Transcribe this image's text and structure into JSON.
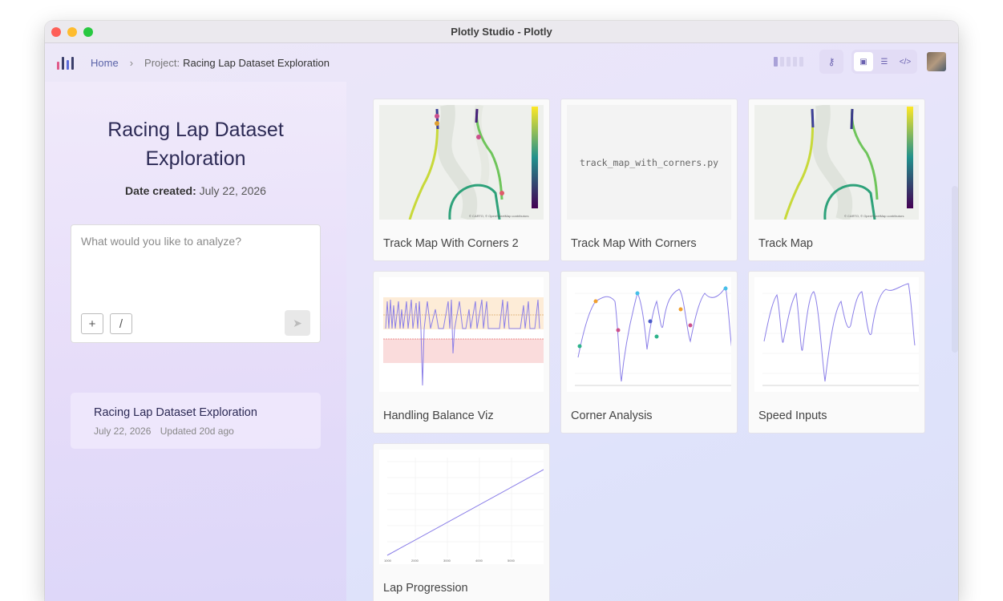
{
  "window": {
    "title": "Plotly Studio - Plotly"
  },
  "breadcrumb": {
    "home": "Home",
    "project_prefix": "Project:",
    "project_name": "Racing Lap Dataset Exploration"
  },
  "project": {
    "title": "Racing Lap Dataset Exploration",
    "date_label": "Date created:",
    "date_value": "July 22, 2026"
  },
  "prompt": {
    "placeholder": "What would you like to analyze?",
    "add_label": "+",
    "slash_label": "/"
  },
  "recent": {
    "title": "Racing Lap Dataset Exploration",
    "date": "July 22, 2026",
    "updated": "Updated 20d ago"
  },
  "cards": [
    {
      "label": "Track Map With Corners 2",
      "kind": "map"
    },
    {
      "label": "Track Map With Corners",
      "kind": "code",
      "code": "track_map_with_corners.py"
    },
    {
      "label": "Track Map",
      "kind": "map"
    },
    {
      "label": "Handling Balance Viz",
      "kind": "balance"
    },
    {
      "label": "Corner Analysis",
      "kind": "corner"
    },
    {
      "label": "Speed Inputs",
      "kind": "speed"
    },
    {
      "label": "Lap Progression",
      "kind": "lap"
    }
  ],
  "colors": {
    "accent": "#5a63a8",
    "title": "#2c2a55",
    "line": "#8b7fe8"
  }
}
